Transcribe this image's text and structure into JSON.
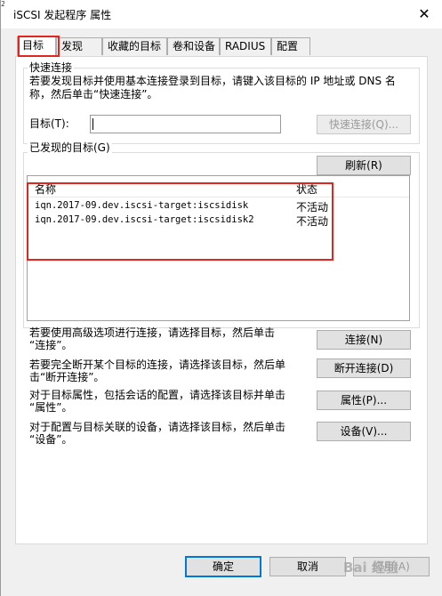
{
  "window": {
    "title": "iSCSI 发起程序 属性",
    "edge_text": "2"
  },
  "tabs": [
    {
      "label": "目标",
      "active": true
    },
    {
      "label": "发现",
      "active": false
    },
    {
      "label": "收藏的目标",
      "active": false
    },
    {
      "label": "卷和设备",
      "active": false
    },
    {
      "label": "RADIUS",
      "active": false
    },
    {
      "label": "配置",
      "active": false
    }
  ],
  "quick_connect": {
    "group_label": "快速连接",
    "description_line1": "若要发现目标并使用基本连接登录到目标，请键入该目标的 IP 地址或 DNS 名",
    "description_line2": "称，然后单击“快速连接”。",
    "target_label": "目标(T):",
    "target_value": "",
    "quick_connect_button": "快速连接(Q)..."
  },
  "discovered": {
    "group_label": "已发现的目标(G)",
    "refresh_button": "刷新(R)",
    "columns": [
      "名称",
      "状态"
    ],
    "rows": [
      {
        "name": "iqn.2017-09.dev.iscsi-target:iscsidisk",
        "status": "不活动"
      },
      {
        "name": "iqn.2017-09.dev.iscsi-target:iscsidisk2",
        "status": "不活动"
      }
    ]
  },
  "actions": [
    {
      "line1": "若要使用高级选项进行连接，请选择目标，然后单击",
      "line2": "“连接”。",
      "button": "连接(N)"
    },
    {
      "line1": "若要完全断开某个目标的连接，请选择该目标，然后单",
      "line2": "击“断开连接”。",
      "button": "断开连接(D)"
    },
    {
      "line1": "对于目标属性，包括会话的配置，请选择该目标并单击",
      "line2": "“属性”。",
      "button": "属性(P)..."
    },
    {
      "line1": "对于配置与目标关联的设备，请选择该目标，然后单击",
      "line2": "“设备”。",
      "button": "设备(V)..."
    }
  ],
  "footer": {
    "ok": "确定",
    "cancel": "取消",
    "apply": "应用(A)"
  },
  "watermark": "Bai 经验",
  "colors": {
    "highlight_red": "#e0261f",
    "focus_blue": "#0078d7"
  }
}
